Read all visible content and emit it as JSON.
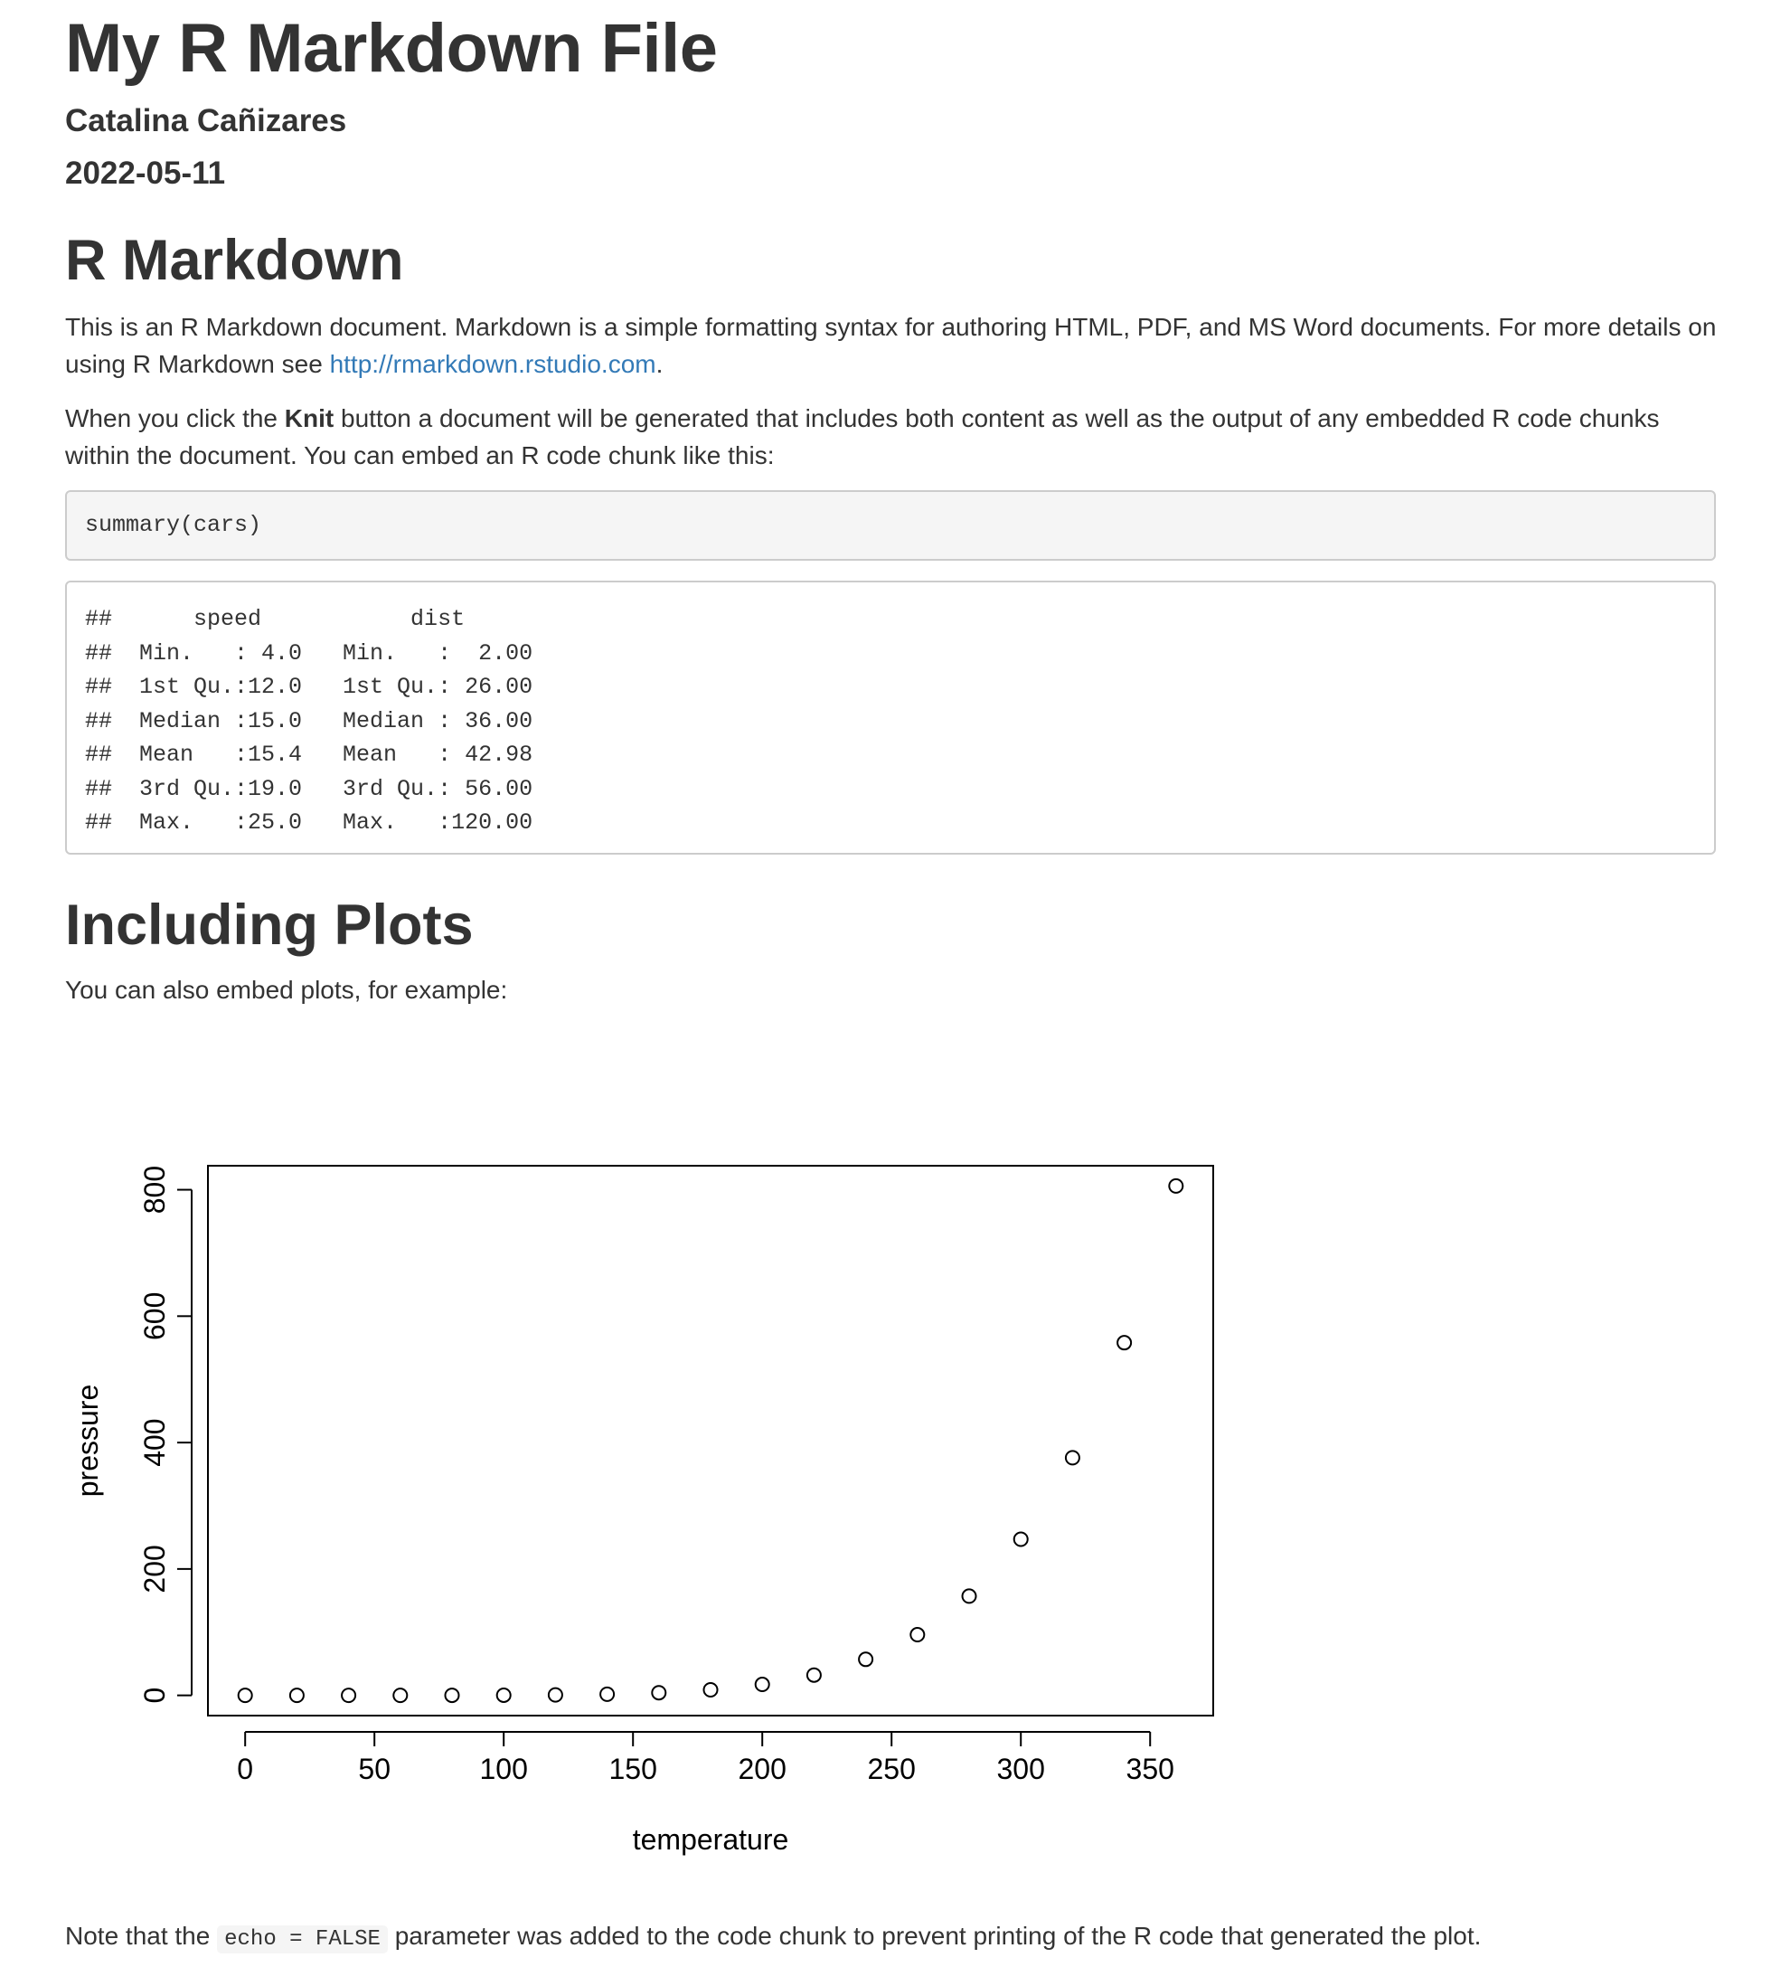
{
  "header": {
    "title": "My R Markdown File",
    "author": "Catalina Cañizares",
    "date": "2022-05-11"
  },
  "section1": {
    "heading": "R Markdown",
    "para1_a": "This is an R Markdown document. Markdown is a simple formatting syntax for authoring HTML, PDF, and MS Word documents. For more details on using R Markdown see ",
    "para1_link": "http://rmarkdown.rstudio.com",
    "para1_b": ".",
    "para2_a": "When you click the ",
    "para2_bold": "Knit",
    "para2_b": " button a document will be generated that includes both content as well as the output of any embedded R code chunks within the document. You can embed an R code chunk like this:",
    "code": "summary(cars)",
    "output_lines": [
      "##      speed           dist       ",
      "##  Min.   : 4.0   Min.   :  2.00  ",
      "##  1st Qu.:12.0   1st Qu.: 26.00  ",
      "##  Median :15.0   Median : 36.00  ",
      "##  Mean   :15.4   Mean   : 42.98  ",
      "##  3rd Qu.:19.0   3rd Qu.: 56.00  ",
      "##  Max.   :25.0   Max.   :120.00  "
    ]
  },
  "section2": {
    "heading": "Including Plots",
    "intro": "You can also embed plots, for example:",
    "note_a": "Note that the ",
    "note_code": "echo = FALSE",
    "note_b": " parameter was added to the code chunk to prevent printing of the R code that generated the plot."
  },
  "chart_data": {
    "type": "scatter",
    "title": "",
    "xlabel": "temperature",
    "ylabel": "pressure",
    "xlim": [
      -14.4,
      374.4
    ],
    "ylim": [
      -32.0,
      838.0
    ],
    "xticks": [
      0,
      50,
      100,
      150,
      200,
      250,
      300,
      350
    ],
    "yticks": [
      0,
      200,
      400,
      600,
      800
    ],
    "grid": false,
    "marker": "open-circle",
    "x": [
      0,
      20,
      40,
      60,
      80,
      100,
      120,
      140,
      160,
      180,
      200,
      220,
      240,
      260,
      280,
      300,
      320,
      340,
      360
    ],
    "y": [
      0.0002,
      0.0012,
      0.006,
      0.03,
      0.09,
      0.27,
      0.75,
      1.85,
      4.2,
      8.8,
      17.3,
      32.1,
      57,
      96,
      157,
      247,
      376,
      558,
      806
    ]
  }
}
